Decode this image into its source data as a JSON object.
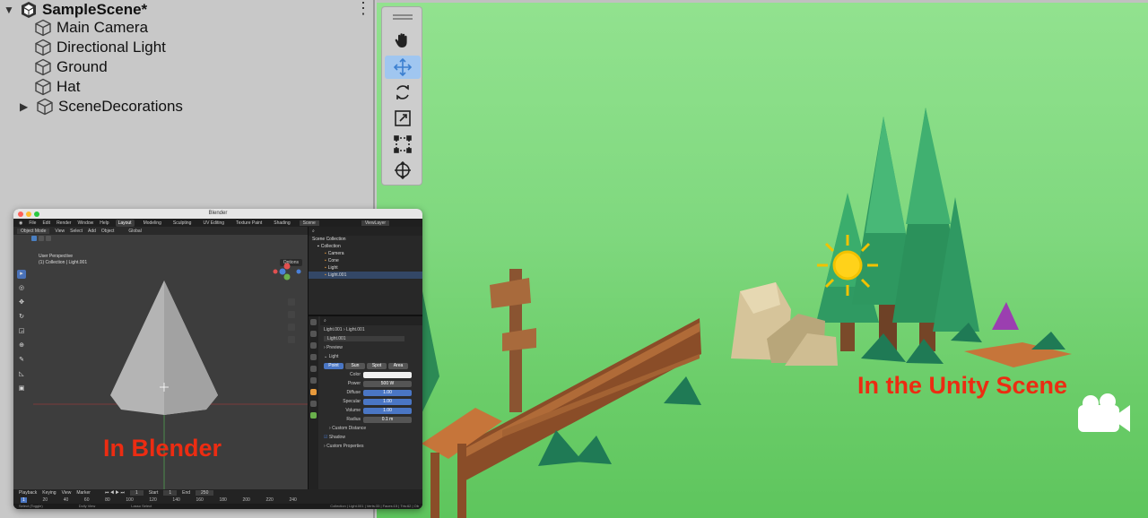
{
  "hierarchy": {
    "scene_name": "SampleScene*",
    "items": [
      {
        "label": "Main Camera",
        "expandable": false
      },
      {
        "label": "Directional Light",
        "expandable": false
      },
      {
        "label": "Ground",
        "expandable": false
      },
      {
        "label": "Hat",
        "expandable": false
      },
      {
        "label": "SceneDecorations",
        "expandable": true
      }
    ]
  },
  "blender": {
    "title": "Blender",
    "menu": [
      "File",
      "Edit",
      "Render",
      "Window",
      "Help"
    ],
    "workspaces": [
      "Layout",
      "Modeling",
      "Sculpting",
      "UV Editing",
      "Texture Paint",
      "Shading"
    ],
    "active_workspace": "Layout",
    "scene_field": "Scene",
    "view_layer_field": "ViewLayer",
    "viewport": {
      "mode": "Object Mode",
      "menus": [
        "View",
        "Select",
        "Add",
        "Object"
      ],
      "transform": "Global",
      "info_line1": "User Perspective",
      "info_line2": "(1) Collection | Light.001",
      "options_label": "Options",
      "overlay_label": "In Blender"
    },
    "outliner": {
      "root": "Scene Collection",
      "collection": "Collection",
      "items": [
        "Camera",
        "Cone",
        "Light",
        "Light.001"
      ]
    },
    "properties": {
      "breadcrumb_object": "Light.001",
      "breadcrumb_data": "Light.001",
      "datablock": "Light.001",
      "preview_label": "Preview",
      "light_label": "Light",
      "light_types": [
        "Point",
        "Sun",
        "Spot",
        "Area"
      ],
      "active_type": "Point",
      "color_label": "Color",
      "power_label": "Power",
      "power_value": "500 W",
      "diffuse_label": "Diffuse",
      "diffuse_value": "1.00",
      "specular_label": "Specular",
      "specular_value": "1.00",
      "volume_label": "Volume",
      "volume_value": "1.00",
      "radius_label": "Radius",
      "radius_value": "0.1 m",
      "custom_distance_label": "Custom Distance",
      "shadow_label": "Shadow",
      "custom_props_label": "Custom Properties"
    },
    "timeline": {
      "menus": [
        "Playback",
        "Keying",
        "View",
        "Marker"
      ],
      "current_frame": "1",
      "start_label": "Start",
      "start_value": "1",
      "end_label": "End",
      "end_value": "250",
      "frame_numbers": [
        "1",
        "20",
        "40",
        "60",
        "80",
        "100",
        "120",
        "140",
        "160",
        "180",
        "200",
        "220",
        "240"
      ]
    },
    "statusbar": {
      "left": "Select (Toggle)",
      "mid": "Dolly View",
      "mid2": "Lasso Select",
      "right": "Collection | Light.001 | Verts:33 | Faces:15 | Tris:62 | Ob"
    }
  },
  "scene": {
    "overlay_label": "In the Unity Scene",
    "tools": [
      "hand-tool",
      "move-tool",
      "rotate-tool",
      "scale-tool",
      "rect-tool",
      "transform-tool"
    ],
    "active_tool": "move-tool"
  },
  "colors": {
    "label_red": "#ec2c12",
    "sky_green": "#8fe08c",
    "blender_select_blue": "#4a76c4",
    "unity_tool_active": "#a0c6f0"
  }
}
